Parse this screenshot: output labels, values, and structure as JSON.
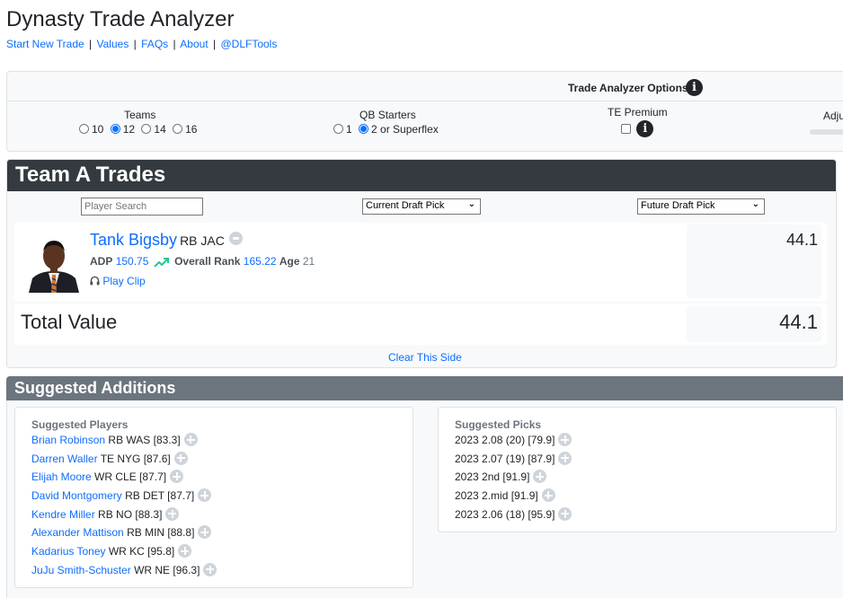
{
  "header": {
    "title": "Dynasty Trade Analyzer",
    "nav": [
      {
        "label": "Start New Trade"
      },
      {
        "label": "Values"
      },
      {
        "label": "FAQs"
      },
      {
        "label": "About"
      },
      {
        "label": "@DLFTools"
      }
    ],
    "separator": "|"
  },
  "options": {
    "title": "Trade Analyzer Options",
    "info_icon": "i",
    "teams": {
      "label": "Teams",
      "options": [
        "10",
        "12",
        "14",
        "16"
      ],
      "selected": "12"
    },
    "qb_starters": {
      "label": "QB Starters",
      "options": [
        "1",
        "2 or Superflex"
      ],
      "selected": "2 or Superflex"
    },
    "te_premium": {
      "label": "TE Premium",
      "checked": false
    },
    "adjust_label": "Adju"
  },
  "team_a": {
    "title": "Team A Trades",
    "player_search_placeholder": "Player Search",
    "current_pick_select": "Current Draft Pick",
    "future_pick_select": "Future Draft Pick",
    "players": [
      {
        "name": "Tank Bigsby",
        "position_team": "RB JAC",
        "adp_label": "ADP",
        "adp": "150.75",
        "trend": "up",
        "rank_label": "Overall Rank",
        "rank": "165.22",
        "age_label": "Age",
        "age": "21",
        "play_clip": "Play Clip",
        "value": "44.1"
      }
    ],
    "total_label": "Total Value",
    "total_value": "44.1",
    "clear_label": "Clear This Side"
  },
  "suggested": {
    "title": "Suggested Additions",
    "players_title": "Suggested Players",
    "players": [
      {
        "name": "Brian Robinson",
        "info": "RB WAS [83.3]"
      },
      {
        "name": "Darren Waller",
        "info": "TE NYG [87.6]"
      },
      {
        "name": "Elijah Moore",
        "info": "WR CLE [87.7]"
      },
      {
        "name": "David Montgomery",
        "info": "RB DET [87.7]"
      },
      {
        "name": "Kendre Miller",
        "info": "RB NO [88.3]"
      },
      {
        "name": "Alexander Mattison",
        "info": "RB MIN [88.8]"
      },
      {
        "name": "Kadarius Toney",
        "info": "WR KC [95.8]"
      },
      {
        "name": "JuJu Smith-Schuster",
        "info": "WR NE [96.3]"
      }
    ],
    "picks_title": "Suggested Picks",
    "picks": [
      {
        "label": "2023 2.08 (20) [79.9]"
      },
      {
        "label": "2023 2.07 (19) [87.9]"
      },
      {
        "label": "2023 2nd [91.9]"
      },
      {
        "label": "2023 2.mid [91.9]"
      },
      {
        "label": "2023 2.06 (18) [95.9]"
      }
    ]
  },
  "colors": {
    "link": "#0d6efd",
    "dark_header": "#343a40",
    "gray_header": "#6c757d",
    "trend_up": "#20c997"
  }
}
